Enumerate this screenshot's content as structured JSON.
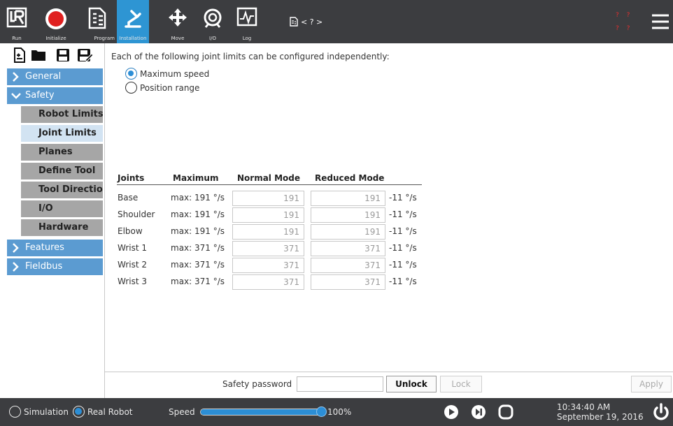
{
  "toolbar": {
    "tabs": [
      {
        "label": "Run",
        "icon": "ur-logo-icon"
      },
      {
        "label": "Initialize",
        "icon": "red-record-icon"
      },
      {
        "label": "Program",
        "icon": "program-icon"
      },
      {
        "label": "Installation",
        "icon": "robot-arm-icon",
        "active": true
      },
      {
        "label": "Move",
        "icon": "move-arrows-icon"
      },
      {
        "label": "I/O",
        "icon": "io-icon"
      },
      {
        "label": "Log",
        "icon": "log-icon"
      }
    ],
    "program_name": "< ? >",
    "status_marks": "? ?"
  },
  "sidebar": {
    "categories": {
      "general": "General",
      "safety": "Safety",
      "features": "Features",
      "fieldbus": "Fieldbus"
    },
    "safety_items": [
      "Robot Limits",
      "Joint Limits",
      "Planes",
      "Define Tool",
      "Tool Direction",
      "I/O",
      "Hardware"
    ],
    "selected": "Joint Limits"
  },
  "main": {
    "intro": "Each of the following joint limits can be configured independently:",
    "options": {
      "max_speed": "Maximum speed",
      "position_range": "Position range"
    },
    "selected_option": "Maximum speed",
    "headers": {
      "joints": "Joints",
      "maximum": "Maximum",
      "normal": "Normal Mode",
      "reduced": "Reduced Mode"
    },
    "rows": [
      {
        "joint": "Base",
        "max": "max: 191 °/s",
        "normal": "191",
        "reduced": "191",
        "delta": "-11 °/s"
      },
      {
        "joint": "Shoulder",
        "max": "max: 191 °/s",
        "normal": "191",
        "reduced": "191",
        "delta": "-11 °/s"
      },
      {
        "joint": "Elbow",
        "max": "max: 191 °/s",
        "normal": "191",
        "reduced": "191",
        "delta": "-11 °/s"
      },
      {
        "joint": "Wrist 1",
        "max": "max: 371 °/s",
        "normal": "371",
        "reduced": "371",
        "delta": "-11 °/s"
      },
      {
        "joint": "Wrist 2",
        "max": "max: 371 °/s",
        "normal": "371",
        "reduced": "371",
        "delta": "-11 °/s"
      },
      {
        "joint": "Wrist 3",
        "max": "max: 371 °/s",
        "normal": "371",
        "reduced": "371",
        "delta": "-11 °/s"
      }
    ]
  },
  "footer": {
    "password_label": "Safety password",
    "password_value": "",
    "unlock": "Unlock",
    "lock": "Lock",
    "apply": "Apply"
  },
  "bottombar": {
    "simulation": "Simulation",
    "real_robot": "Real Robot",
    "selected_mode": "Real Robot",
    "speed_label": "Speed",
    "speed_value": "100%",
    "speed_fraction": 1.0,
    "time": "10:34:40 AM",
    "date": "September 19, 2016"
  },
  "colors": {
    "accent": "#2c8ed6",
    "category": "#5b9bd1",
    "bar": "#3c3d40",
    "alert": "#e62e2e"
  }
}
